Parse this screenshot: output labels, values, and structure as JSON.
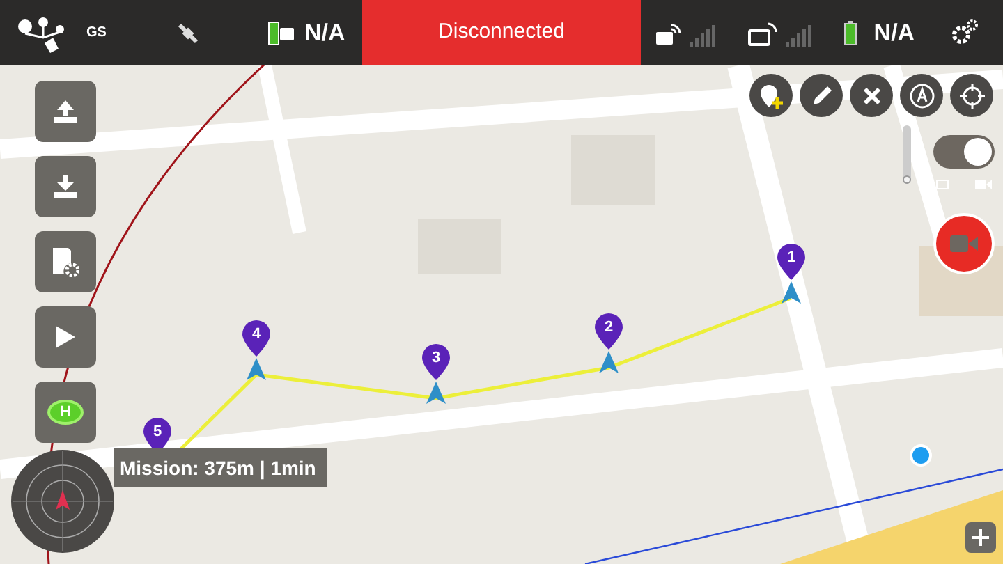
{
  "top_bar": {
    "app_label": "GS",
    "remote_battery": "N/A",
    "connection_status": "Disconnected",
    "aircraft_battery": "N/A"
  },
  "side_buttons": [
    {
      "kind": "upload"
    },
    {
      "kind": "download"
    },
    {
      "kind": "settings"
    },
    {
      "kind": "play"
    },
    {
      "kind": "home",
      "label": "H"
    }
  ],
  "waypoints": [
    {
      "label": "1"
    },
    {
      "label": "2"
    },
    {
      "label": "3"
    },
    {
      "label": "4"
    },
    {
      "label": "5"
    }
  ],
  "mission_summary": "Mission: 375m | 1min",
  "camera": {
    "zoom": {
      "level": 0.05
    },
    "video_mode": {
      "on": true
    }
  }
}
